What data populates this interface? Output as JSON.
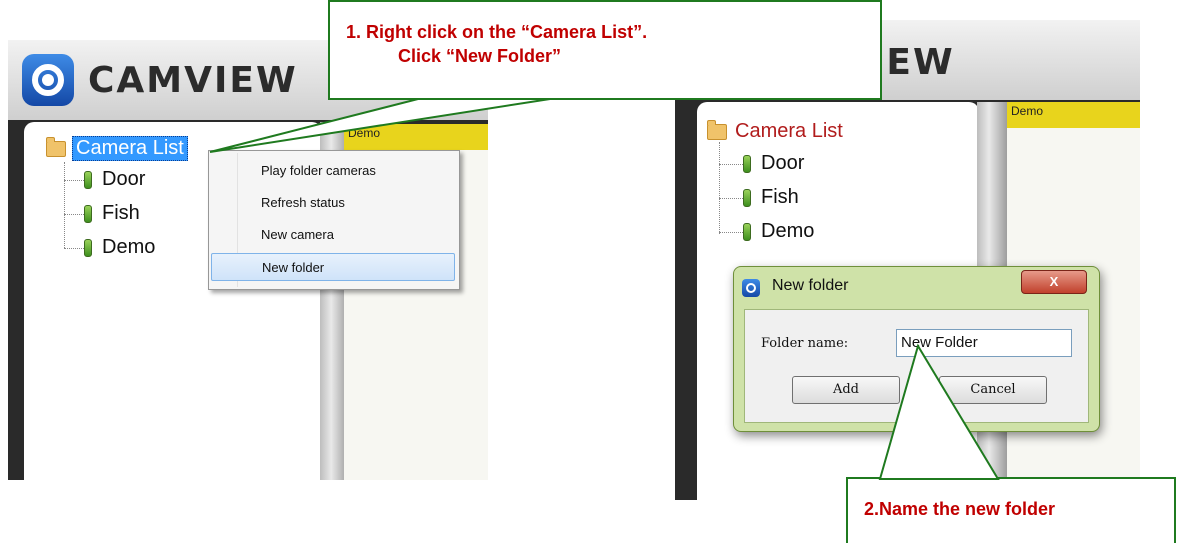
{
  "left": {
    "logo_text": "CAMVIEW",
    "tree": {
      "root": "Camera List",
      "items": [
        "Door",
        "Fish",
        "Demo"
      ]
    },
    "right_panel_header": "Demo",
    "context_menu": {
      "items": [
        "Play folder cameras",
        "Refresh status",
        "New camera",
        "New folder"
      ],
      "highlighted": "New folder"
    }
  },
  "right": {
    "logo_text": "IEW",
    "tree": {
      "root": "Camera List",
      "items": [
        "Door",
        "Fish",
        "Demo"
      ]
    },
    "right_panel_header": "Demo",
    "dialog": {
      "title": "New folder",
      "close_label": "X",
      "field_label": "Folder name:",
      "field_value": "New Folder",
      "add_label": "Add",
      "cancel_label": "Cancel"
    }
  },
  "callouts": {
    "step1_line1": "1.   Right click on the “Camera List”.",
    "step1_line2": "Click “New Folder”",
    "step2": "2.Name the new folder"
  },
  "colors": {
    "callout_text": "#c00000",
    "callout_border": "#1f7a1f",
    "selection": "#3399ff",
    "demo_header": "#e8d41c"
  }
}
